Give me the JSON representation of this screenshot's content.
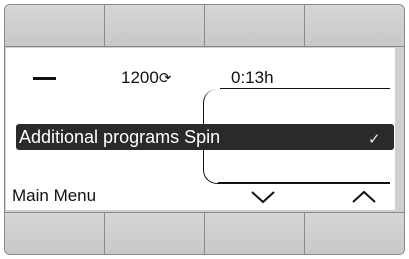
{
  "top_softkeys": [
    "",
    "",
    "",
    ""
  ],
  "bottom_softkeys": [
    "",
    "",
    "",
    ""
  ],
  "status": {
    "spin_speed": "1200",
    "spin_icon": "spin-icon",
    "duration": "0:13h"
  },
  "selection": {
    "category": "Additional programs",
    "value": "Spin",
    "check_icon": "checkmark-icon"
  },
  "footer": {
    "menu_label": "Main Menu",
    "down_icon": "chevron-down-icon",
    "up_icon": "chevron-up-icon"
  }
}
